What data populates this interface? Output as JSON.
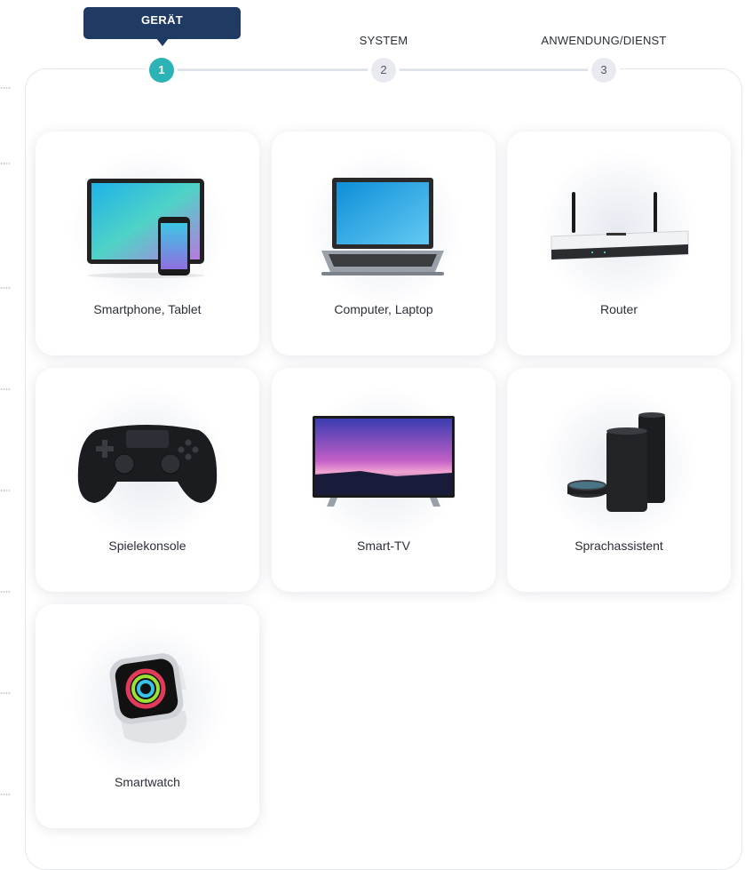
{
  "stepper": {
    "steps": [
      {
        "number": "1",
        "label": "GERÄT",
        "state": "active"
      },
      {
        "number": "2",
        "label": "SYSTEM",
        "state": "inactive"
      },
      {
        "number": "3",
        "label": "ANWENDUNG/DIENST",
        "state": "inactive"
      }
    ]
  },
  "devices": [
    {
      "label": "Smartphone, Tablet",
      "icon": "tablet-phone-icon"
    },
    {
      "label": "Computer, Laptop",
      "icon": "laptop-icon"
    },
    {
      "label": "Router",
      "icon": "router-icon"
    },
    {
      "label": "Spielekonsole",
      "icon": "gamepad-icon"
    },
    {
      "label": "Smart-TV",
      "icon": "tv-icon"
    },
    {
      "label": "Sprachassistent",
      "icon": "smart-speaker-icon"
    },
    {
      "label": "Smartwatch",
      "icon": "smartwatch-icon"
    }
  ],
  "colors": {
    "active_step": "#2bb3b5",
    "label_bg": "#1f3a63",
    "inactive_step": "#e9eaf0"
  }
}
